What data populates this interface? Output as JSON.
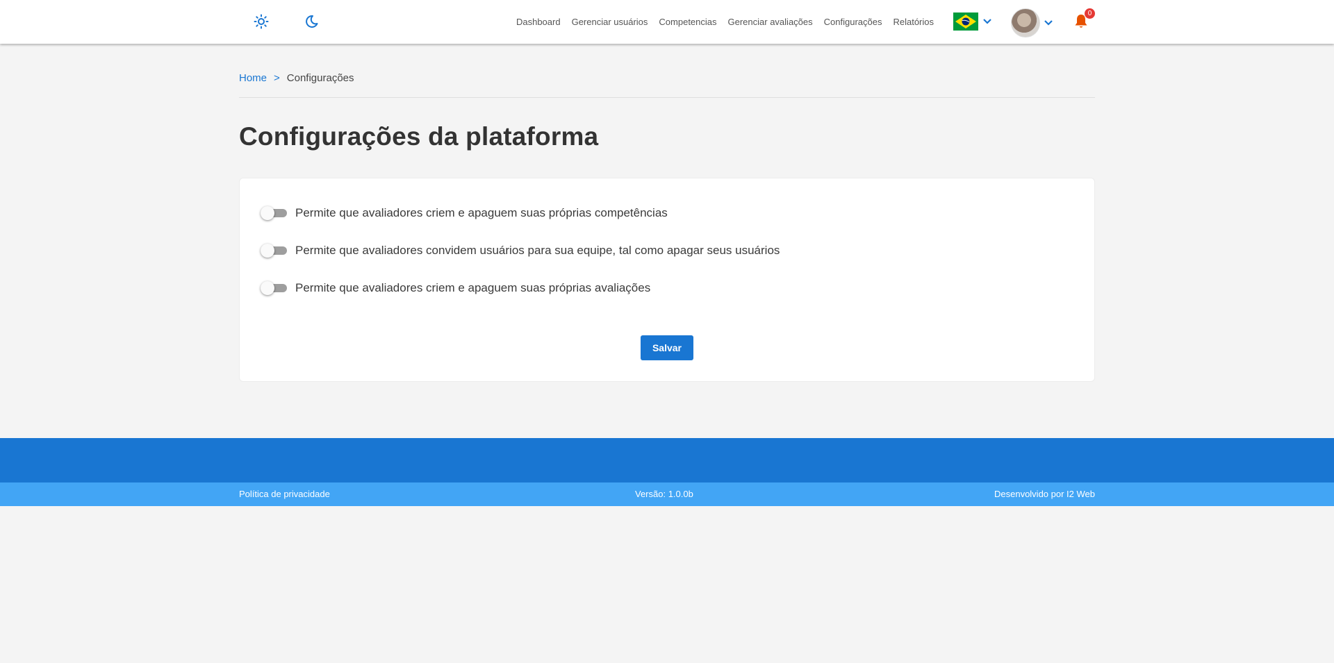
{
  "colors": {
    "primary": "#1976d2",
    "footer_bottom": "#42a5f5",
    "notification": "#e65100",
    "badge": "#e53935",
    "background": "#f4f4f4"
  },
  "header": {
    "theme_light_icon": "sun-icon",
    "theme_dark_icon": "moon-icon",
    "nav": [
      "Dashboard",
      "Gerenciar usuários",
      "Competencias",
      "Gerenciar avaliações",
      "Configurações",
      "Relatórios"
    ],
    "language_icon": "brazil-flag-icon",
    "notifications_count": "0"
  },
  "breadcrumb": {
    "home": "Home",
    "separator": ">",
    "current": "Configurações"
  },
  "page_title": "Configurações da plataforma",
  "settings": [
    {
      "label": "Permite que avaliadores criem e apaguem suas próprias competências",
      "enabled": false
    },
    {
      "label": "Permite que avaliadores convidem usuários para sua equipe, tal como apagar seus usuários",
      "enabled": false
    },
    {
      "label": "Permite que avaliadores criem e apaguem suas próprias avaliações",
      "enabled": false
    }
  ],
  "save_label": "Salvar",
  "footer": {
    "privacy": "Política de privacidade",
    "version": "Versão: 1.0.0b",
    "developer": "Desenvolvido por I2 Web"
  }
}
